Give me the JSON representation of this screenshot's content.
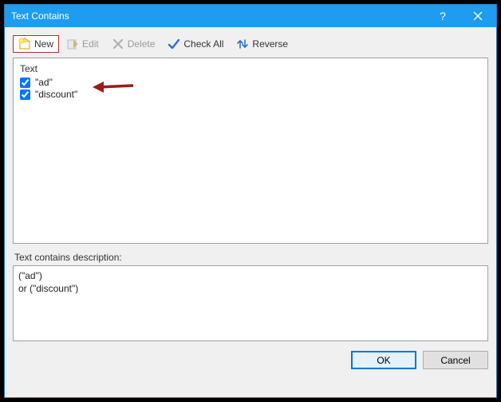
{
  "title": "Text Contains",
  "toolbar": {
    "new": "New",
    "edit": "Edit",
    "delete": "Delete",
    "check_all": "Check All",
    "reverse": "Reverse"
  },
  "list": {
    "header": "Text",
    "items": [
      {
        "checked": true,
        "label": "\"ad\""
      },
      {
        "checked": true,
        "label": "\"discount\""
      }
    ]
  },
  "desc_label": "Text contains description:",
  "desc_text": "(\"ad\")\nor (\"discount\")",
  "buttons": {
    "ok": "OK",
    "cancel": "Cancel"
  }
}
